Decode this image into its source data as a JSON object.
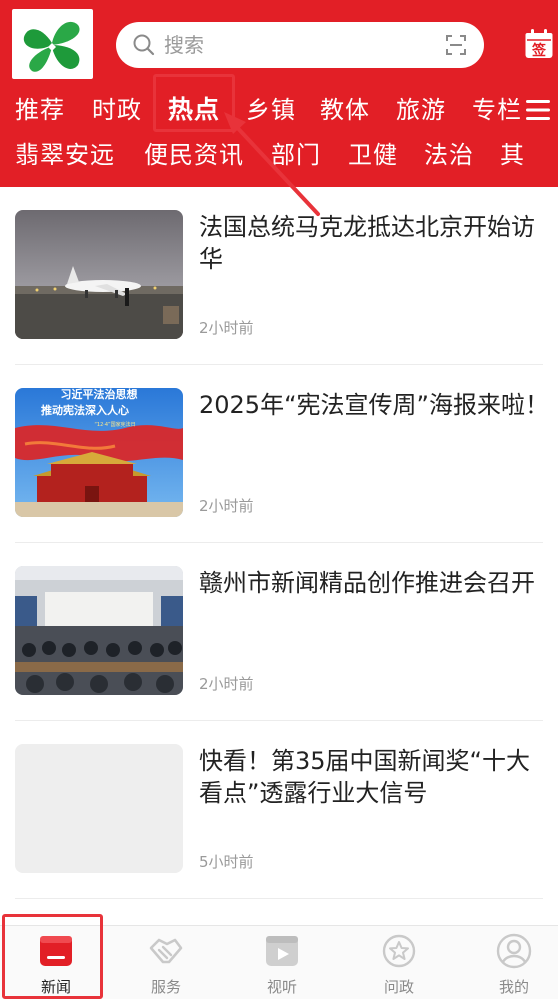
{
  "header": {
    "search_placeholder": "搜索",
    "sign_label": "签",
    "accent_color": "#e21f26"
  },
  "tabs_row1": [
    "推荐",
    "时政",
    "热点",
    "乡镇",
    "教体",
    "旅游",
    "专栏"
  ],
  "tabs_row2": [
    "翡翠安远",
    "便民资讯",
    "部门",
    "卫健",
    "法治",
    "其"
  ],
  "active_tab": "热点",
  "news": [
    {
      "title": "法国总统马克龙抵达北京开始访华",
      "time": "2小时前"
    },
    {
      "title": "2025年“宪法宣传周”海报来啦！",
      "time": "2小时前",
      "thumb_text": [
        "习近平法治思想",
        "推动宪法深入人心",
        "“12·4”国家宪法日"
      ]
    },
    {
      "title": "赣州市新闻精品创作推进会召开",
      "time": "2小时前"
    },
    {
      "title": "快看！第35届中国新闻奖“十大看点”透露行业大信号",
      "time": "5小时前"
    }
  ],
  "bottom_nav": [
    {
      "label": "新闻",
      "icon": "news-icon",
      "active": true
    },
    {
      "label": "服务",
      "icon": "handshake-icon",
      "active": false
    },
    {
      "label": "视听",
      "icon": "video-play-icon",
      "active": false
    },
    {
      "label": "问政",
      "icon": "star-badge-icon",
      "active": false
    },
    {
      "label": "我的",
      "icon": "user-icon",
      "active": false
    }
  ]
}
